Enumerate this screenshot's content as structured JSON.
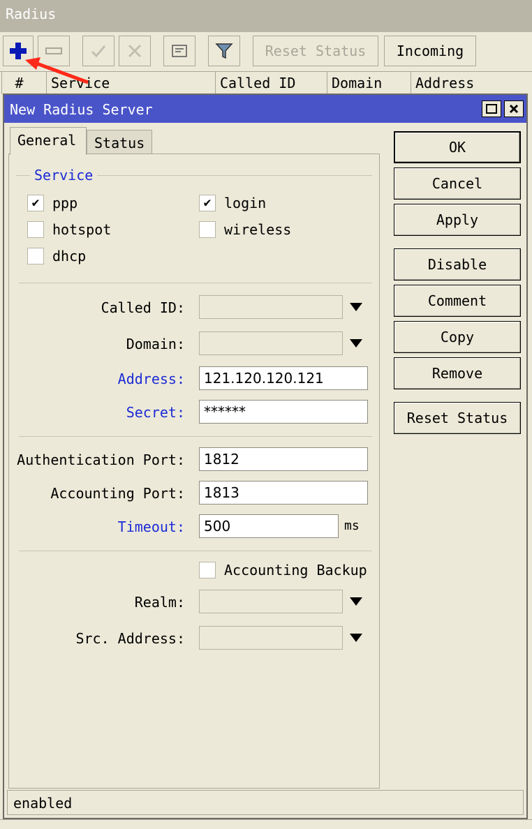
{
  "outer_window": {
    "title": "Radius",
    "toolbar": {
      "reset_status": "Reset Status",
      "incoming": "Incoming"
    },
    "columns": [
      "#",
      "Service",
      "Called ID",
      "Domain",
      "Address"
    ]
  },
  "dialog": {
    "title": "New Radius Server",
    "tabs": [
      "General",
      "Status"
    ],
    "service": {
      "legend": "Service",
      "options": [
        {
          "label": "ppp",
          "checked": true
        },
        {
          "label": "login",
          "checked": true
        },
        {
          "label": "hotspot",
          "checked": false
        },
        {
          "label": "wireless",
          "checked": false
        },
        {
          "label": "dhcp",
          "checked": false
        }
      ]
    },
    "fields": {
      "called_id": {
        "label": "Called ID:",
        "value": ""
      },
      "domain": {
        "label": "Domain:",
        "value": ""
      },
      "address": {
        "label": "Address:",
        "value": "121.120.120.121"
      },
      "secret": {
        "label": "Secret:",
        "value": "******"
      },
      "auth_port": {
        "label": "Authentication Port:",
        "value": "1812"
      },
      "acct_port": {
        "label": "Accounting Port:",
        "value": "1813"
      },
      "timeout": {
        "label": "Timeout:",
        "value": "500",
        "unit": "ms"
      },
      "accounting_backup": {
        "label": "Accounting Backup",
        "checked": false
      },
      "realm": {
        "label": "Realm:",
        "value": ""
      },
      "src_address": {
        "label": "Src. Address:",
        "value": ""
      }
    },
    "buttons": {
      "ok": "OK",
      "cancel": "Cancel",
      "apply": "Apply",
      "disable": "Disable",
      "comment": "Comment",
      "copy": "Copy",
      "remove": "Remove",
      "reset_status": "Reset Status"
    },
    "status_text": "enabled"
  },
  "colors": {
    "title_bar": "#4a54c9",
    "blue_label": "#1c2bd6",
    "background": "#ece9d8",
    "annotation_arrow": "#ff2a1a"
  }
}
